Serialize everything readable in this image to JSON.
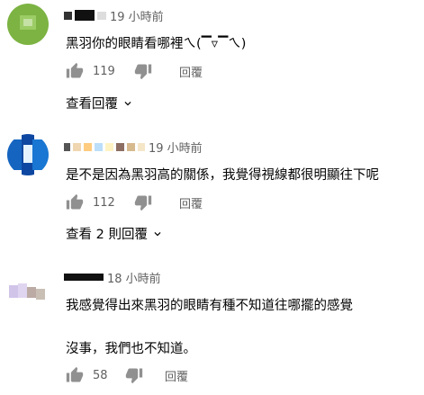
{
  "comments": [
    {
      "time": "19 小時前",
      "text": "黑羽你的眼睛看哪裡ㄟ(▔▿▔ㄟ)",
      "likes": "119",
      "reply_label": "回覆",
      "view_replies": "查看回覆",
      "avatar_color": "#7cb342"
    },
    {
      "time": "19 小時前",
      "text": "是不是因為黑羽高的關係，我覺得視線都很明顯往下呢",
      "likes": "112",
      "reply_label": "回覆",
      "view_replies": "查看 2 則回覆",
      "avatar_color": "#1565c0"
    },
    {
      "time": "18 小時前",
      "text": "我感覺得出來黑羽的眼睛有種不知道往哪擺的感覺",
      "text2": "沒事，我們也不知道。",
      "likes": "58",
      "reply_label": "回覆",
      "avatar_color": "#d7ccc8"
    }
  ],
  "icons": {
    "like": "thumb-up-icon",
    "dislike": "thumb-down-icon",
    "expand": "chevron-down-icon"
  }
}
